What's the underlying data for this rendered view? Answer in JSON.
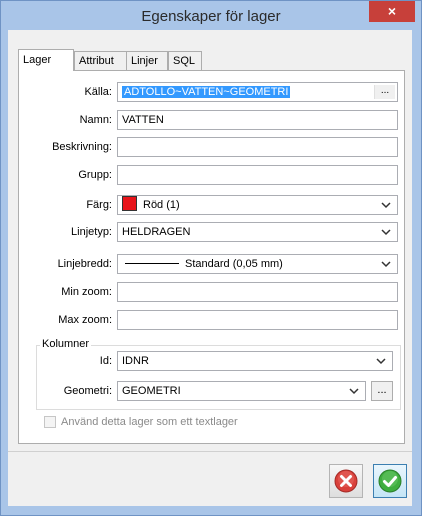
{
  "window": {
    "title": "Egenskaper för lager",
    "close_glyph": "×"
  },
  "tabs": [
    {
      "label": "Lager",
      "active": true
    },
    {
      "label": "Attribut",
      "active": false
    },
    {
      "label": "Linjer",
      "active": false
    },
    {
      "label": "SQL",
      "active": false
    }
  ],
  "form": {
    "kalla": {
      "label": "Källa:",
      "value": "ADTOLLO~VATTEN~GEOMETRI",
      "browse": "..."
    },
    "namn": {
      "label": "Namn:",
      "value": "VATTEN"
    },
    "beskrivning": {
      "label": "Beskrivning:",
      "value": ""
    },
    "grupp": {
      "label": "Grupp:",
      "value": ""
    },
    "farg": {
      "label": "Färg:",
      "value": "Röd (1)",
      "swatch_color": "#e8141a"
    },
    "linjetyp": {
      "label": "Linjetyp:",
      "value": "HELDRAGEN"
    },
    "linjebredd": {
      "label": "Linjebredd:",
      "value": "Standard (0,05 mm)"
    },
    "min_zoom": {
      "label": "Min zoom:",
      "value": ""
    },
    "max_zoom": {
      "label": "Max zoom:",
      "value": ""
    }
  },
  "kolumner": {
    "title": "Kolumner",
    "id": {
      "label": "Id:",
      "value": "IDNR"
    },
    "geometri": {
      "label": "Geometri:",
      "value": "GEOMETRI",
      "browse": "..."
    }
  },
  "textlager": {
    "label": "Använd detta lager som ett textlager",
    "checked": false,
    "enabled": false
  },
  "buttons": {
    "cancel_icon": "cancel-icon",
    "ok_icon": "ok-check-icon",
    "cancel_color": "#d9403a",
    "ok_color": "#3fae3f"
  }
}
